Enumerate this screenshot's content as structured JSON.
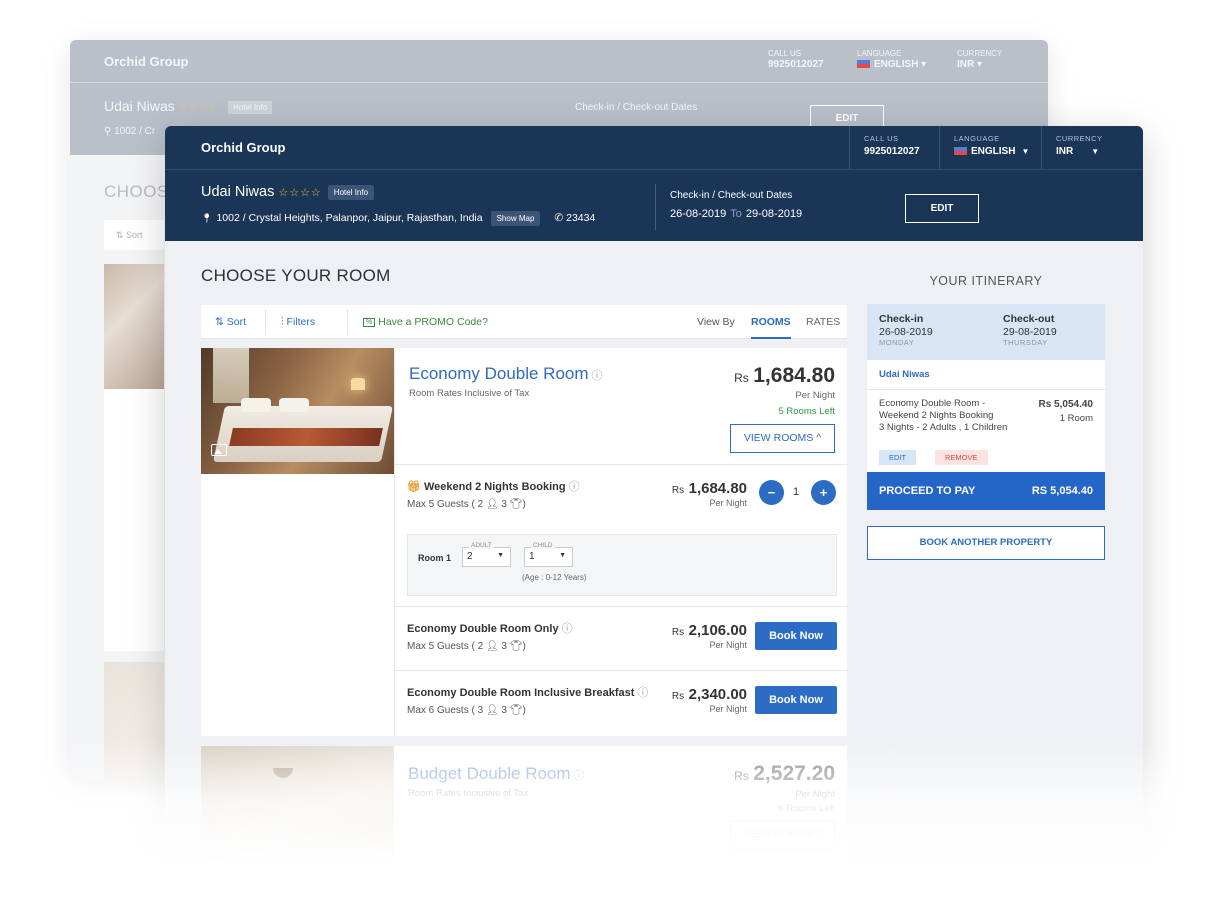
{
  "header": {
    "brand": "Orchid Group",
    "call_label": "CALL US",
    "call_number": "9925012027",
    "language_label": "LANGUAGE",
    "language_value": "ENGLISH",
    "currency_label": "CURRENCY",
    "currency_value": "INR"
  },
  "hotel": {
    "name": "Udai Niwas",
    "stars": "☆☆☆☆",
    "info_label": "Hotel Info",
    "address": "1002 / Crystal Heights, Palanpor, Jaipur, Rajasthan, India",
    "show_map_label": "Show Map",
    "phone": "23434",
    "dates_label": "Check-in / Check-out Dates",
    "checkin": "26-08-2019",
    "to_label": "To",
    "checkout": "29-08-2019",
    "edit_label": "EDIT"
  },
  "main": {
    "title": "CHOOSE YOUR ROOM",
    "sort_label": "Sort",
    "filters_label": "Filters",
    "promo_label": "Have a PROMO Code?",
    "view_by_label": "View By",
    "rooms_tab": "ROOMS",
    "rates_tab": "RATES"
  },
  "rooms": [
    {
      "name": "Economy Double Room",
      "subtitle": "Room Rates Inclusive of Tax",
      "currency": "Rs",
      "price": "1,684.80",
      "per_night": "Per Night",
      "rooms_left": "5 Rooms Left",
      "view_rooms_label": "VIEW ROOMS ^",
      "packages": [
        {
          "name": "Weekend 2 Nights Booking",
          "guests": "Max 5 Guests ( 2",
          "guests_child": "3",
          "currency": "Rs",
          "price": "1,684.80",
          "per_night": "Per Night",
          "qty": "1",
          "occupancy": {
            "room_label": "Room 1",
            "adult_label": "ADULT",
            "adult_value": "2",
            "child_label": "CHILD",
            "child_value": "1",
            "age_note": "(Age : 0-12 Years)"
          }
        },
        {
          "name": "Economy Double Room Only",
          "guests": "Max 5 Guests ( 2",
          "guests_child": "3",
          "currency": "Rs",
          "price": "2,106.00",
          "per_night": "Per Night",
          "book_label": "Book Now"
        },
        {
          "name": "Economy Double Room Inclusive Breakfast",
          "guests": "Max 6 Guests ( 3",
          "guests_child": "3",
          "currency": "Rs",
          "price": "2,340.00",
          "per_night": "Per Night",
          "book_label": "Book Now"
        }
      ]
    },
    {
      "name": "Budget Double Room",
      "subtitle": "Room Rates Inclusive of Tax",
      "currency": "Rs",
      "price": "2,527.20",
      "per_night": "Per Night",
      "rooms_left": "6 Rooms Left",
      "view_rooms_label": "VIEW ROOMS ^"
    }
  ],
  "itinerary": {
    "title": "YOUR ITINERARY",
    "checkin_label": "Check-in",
    "checkin_date": "26-08-2019",
    "checkin_day": "MONDAY",
    "checkout_label": "Check-out",
    "checkout_date": "29-08-2019",
    "checkout_day": "THURSDAY",
    "hotel_name": "Udai Niwas",
    "line_item": "Economy Double Room - Weekend 2 Nights Booking",
    "line_meta": "3 Nights - 2 Adults , 1 Children",
    "line_price": "Rs 5,054.40",
    "line_rooms": "1 Room",
    "edit_label": "EDIT",
    "remove_label": "REMOVE",
    "proceed_label": "PROCEED TO PAY",
    "proceed_total": "RS 5,054.40",
    "book_another_label": "BOOK ANOTHER PROPERTY"
  },
  "colors": {
    "navy": "#1b3556",
    "accent": "#2c6cc4",
    "success": "#2f9a3a",
    "star": "#f0c232"
  }
}
